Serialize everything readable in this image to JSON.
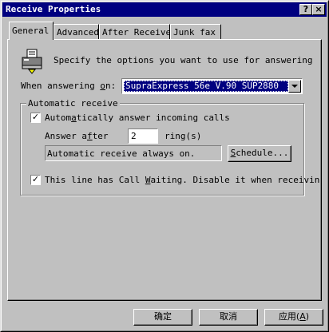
{
  "window": {
    "title": "Receive Properties",
    "help_glyph": "?",
    "close_glyph": "×"
  },
  "tabs": [
    {
      "label": "General",
      "active": true
    },
    {
      "label": "Advanced",
      "active": false
    },
    {
      "label": "After Receive",
      "active": false
    },
    {
      "label": "Junk fax",
      "active": false
    }
  ],
  "general": {
    "intro": "Specify the options you want to use for answering",
    "when_label_pre": "When answering ",
    "when_label_key": "o",
    "when_label_post": "n:",
    "device_value": "SupraExpress 56e V.90 SUP2880",
    "group_title": "Automatic receive",
    "auto_answer": {
      "checked": true,
      "label_pre": "Autom",
      "label_key": "a",
      "label_post": "tically answer incoming calls"
    },
    "answer_after_pre": "Answer a",
    "answer_after_key": "f",
    "answer_after_post": "ter",
    "rings_value": "2",
    "rings_suffix": "ring(s)",
    "status_text": "Automatic receive always on.",
    "schedule_pre": "",
    "schedule_key": "S",
    "schedule_post": "chedule...",
    "call_waiting": {
      "checked": true,
      "label_pre": "This line has Call ",
      "label_key": "W",
      "label_post": "aiting. Disable it when receivin"
    }
  },
  "footer": {
    "ok": "确定",
    "cancel": "取消",
    "apply_pre": "应用(",
    "apply_key": "A",
    "apply_post": ")"
  },
  "colors": {
    "titlebar": "#000080",
    "face": "#c0c0c0",
    "selection": "#000080"
  }
}
